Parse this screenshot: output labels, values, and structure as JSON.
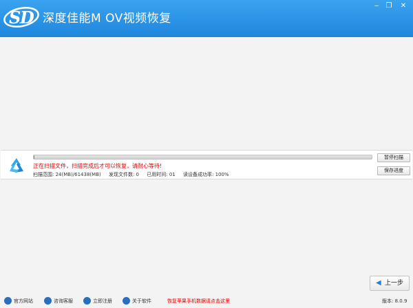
{
  "window": {
    "title": "深度佳能M OV视频恢复",
    "logo_text": "SD",
    "controls": {
      "minimize": "‒",
      "restore": "❐",
      "close": "✕"
    }
  },
  "colors": {
    "titlebar": "#1f86dc",
    "progress": "#3ba0ea",
    "status_red": "#e00000"
  },
  "scan": {
    "progress_fraction": 0.0004,
    "status": "正在扫描文件，扫描完成后才可以恢复，请耐心等待!",
    "range_label": "扫描范围: 24(MB)/61438(MB)",
    "found_label": "发现文件数: 0",
    "elapsed_label": "已用时间: 01",
    "success_label": "读设备成功率: 100%",
    "pause_button": "暂停扫描",
    "save_button": "保存进度"
  },
  "nav": {
    "back_label": "上一步",
    "back_icon": "left-arrow-icon"
  },
  "footer": {
    "links": [
      {
        "label": "官方网站",
        "icon": "home-icon",
        "color": "#2a6fbf"
      },
      {
        "label": "咨询客服",
        "icon": "support-icon",
        "color": "#2a6fbf"
      },
      {
        "label": "立即注册",
        "icon": "register-icon",
        "color": "#2a6fbf"
      },
      {
        "label": "关于软件",
        "icon": "info-icon",
        "color": "#2a6fbf"
      }
    ],
    "promo": "恢复苹果手机数据请点击这里",
    "version": "版本: 8.0.9"
  }
}
